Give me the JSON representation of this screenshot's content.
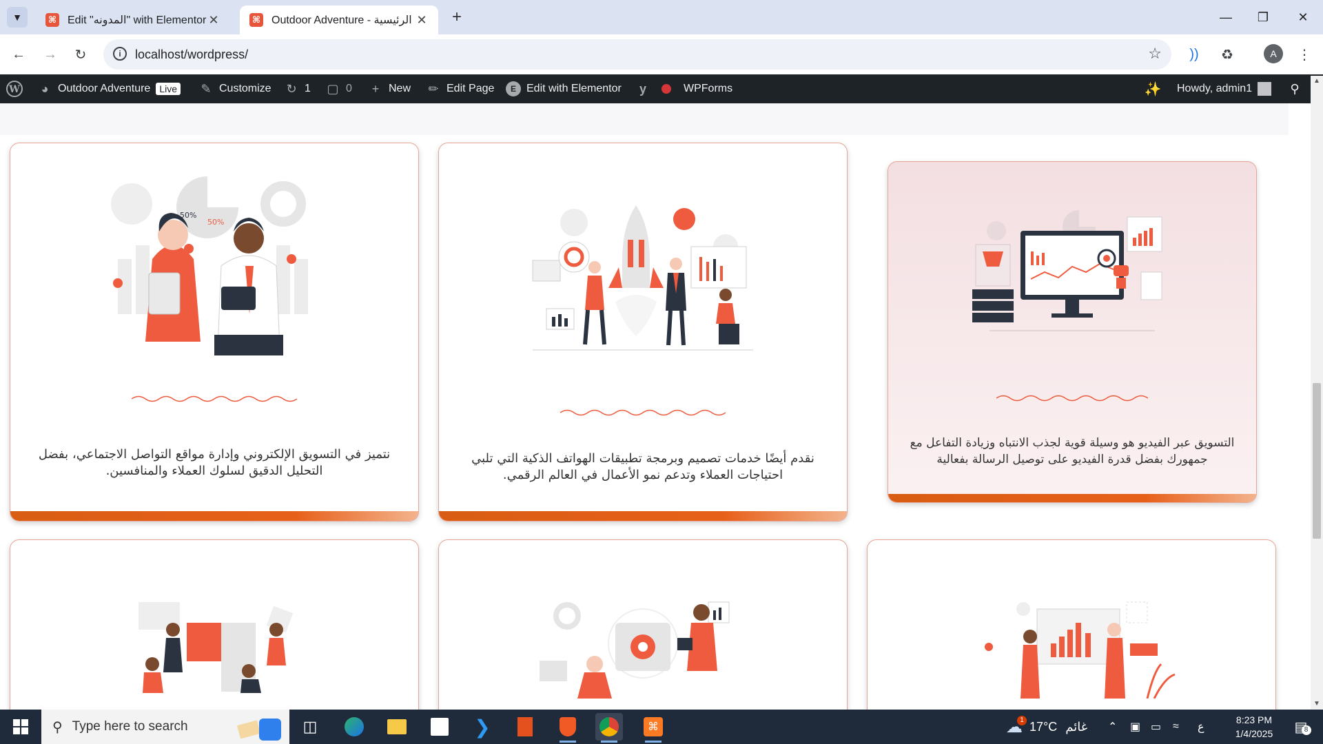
{
  "browser": {
    "tabs": [
      {
        "title": "Edit \"المدونه\" with Elementor",
        "active": false
      },
      {
        "title": "Outdoor Adventure - الرئيسية",
        "active": true
      }
    ],
    "new_tab_icon": "plus-icon",
    "url": "localhost/wordpress/",
    "profile_initial": "A"
  },
  "adminbar": {
    "site_name": "Outdoor Adventure",
    "live_label": "Live",
    "customize_label": "Customize",
    "updates_count": "1",
    "comments_count": "0",
    "new_label": "New",
    "edit_page_label": "Edit Page",
    "elementor_label": "Edit with Elementor",
    "wpforms_label": "WPForms",
    "howdy_label": "Howdy, admin1"
  },
  "cards": [
    {
      "text": "نتميز في التسويق الإلكتروني وإدارة مواقع التواصل الاجتماعي، بفضل التحليل الدقيق لسلوك العملاء والمنافسين.",
      "illustration": "marketing-team-illustration"
    },
    {
      "text": "نقدم أيضًا خدمات تصميم وبرمجة تطبيقات الهواتف الذكية التي تلبي احتياجات العملاء وتدعم نمو الأعمال في العالم الرقمي.",
      "illustration": "rocket-launch-illustration"
    },
    {
      "text": "التسويق عبر الفيديو هو وسيلة قوية لجذب الانتباه وزيادة التفاعل مع جمهورك بفضل قدرة الفيديو على توصيل الرسالة بفعالية",
      "illustration": "video-dashboard-illustration"
    },
    {
      "illustration": "puzzle-team-illustration"
    },
    {
      "illustration": "gear-presentation-illustration"
    },
    {
      "illustration": "analytics-board-illustration"
    }
  ],
  "colors": {
    "accent": "#ef5b3f",
    "bar": "#e0621a",
    "dark": "#2b3240"
  },
  "taskbar": {
    "search_placeholder": "Type here to search",
    "temperature": "17°C",
    "weather_text": "غائم",
    "input_lang": "ع",
    "time": "8:23 PM",
    "date": "1/4/2025",
    "notification_count": "8",
    "weather_badge": "1"
  }
}
